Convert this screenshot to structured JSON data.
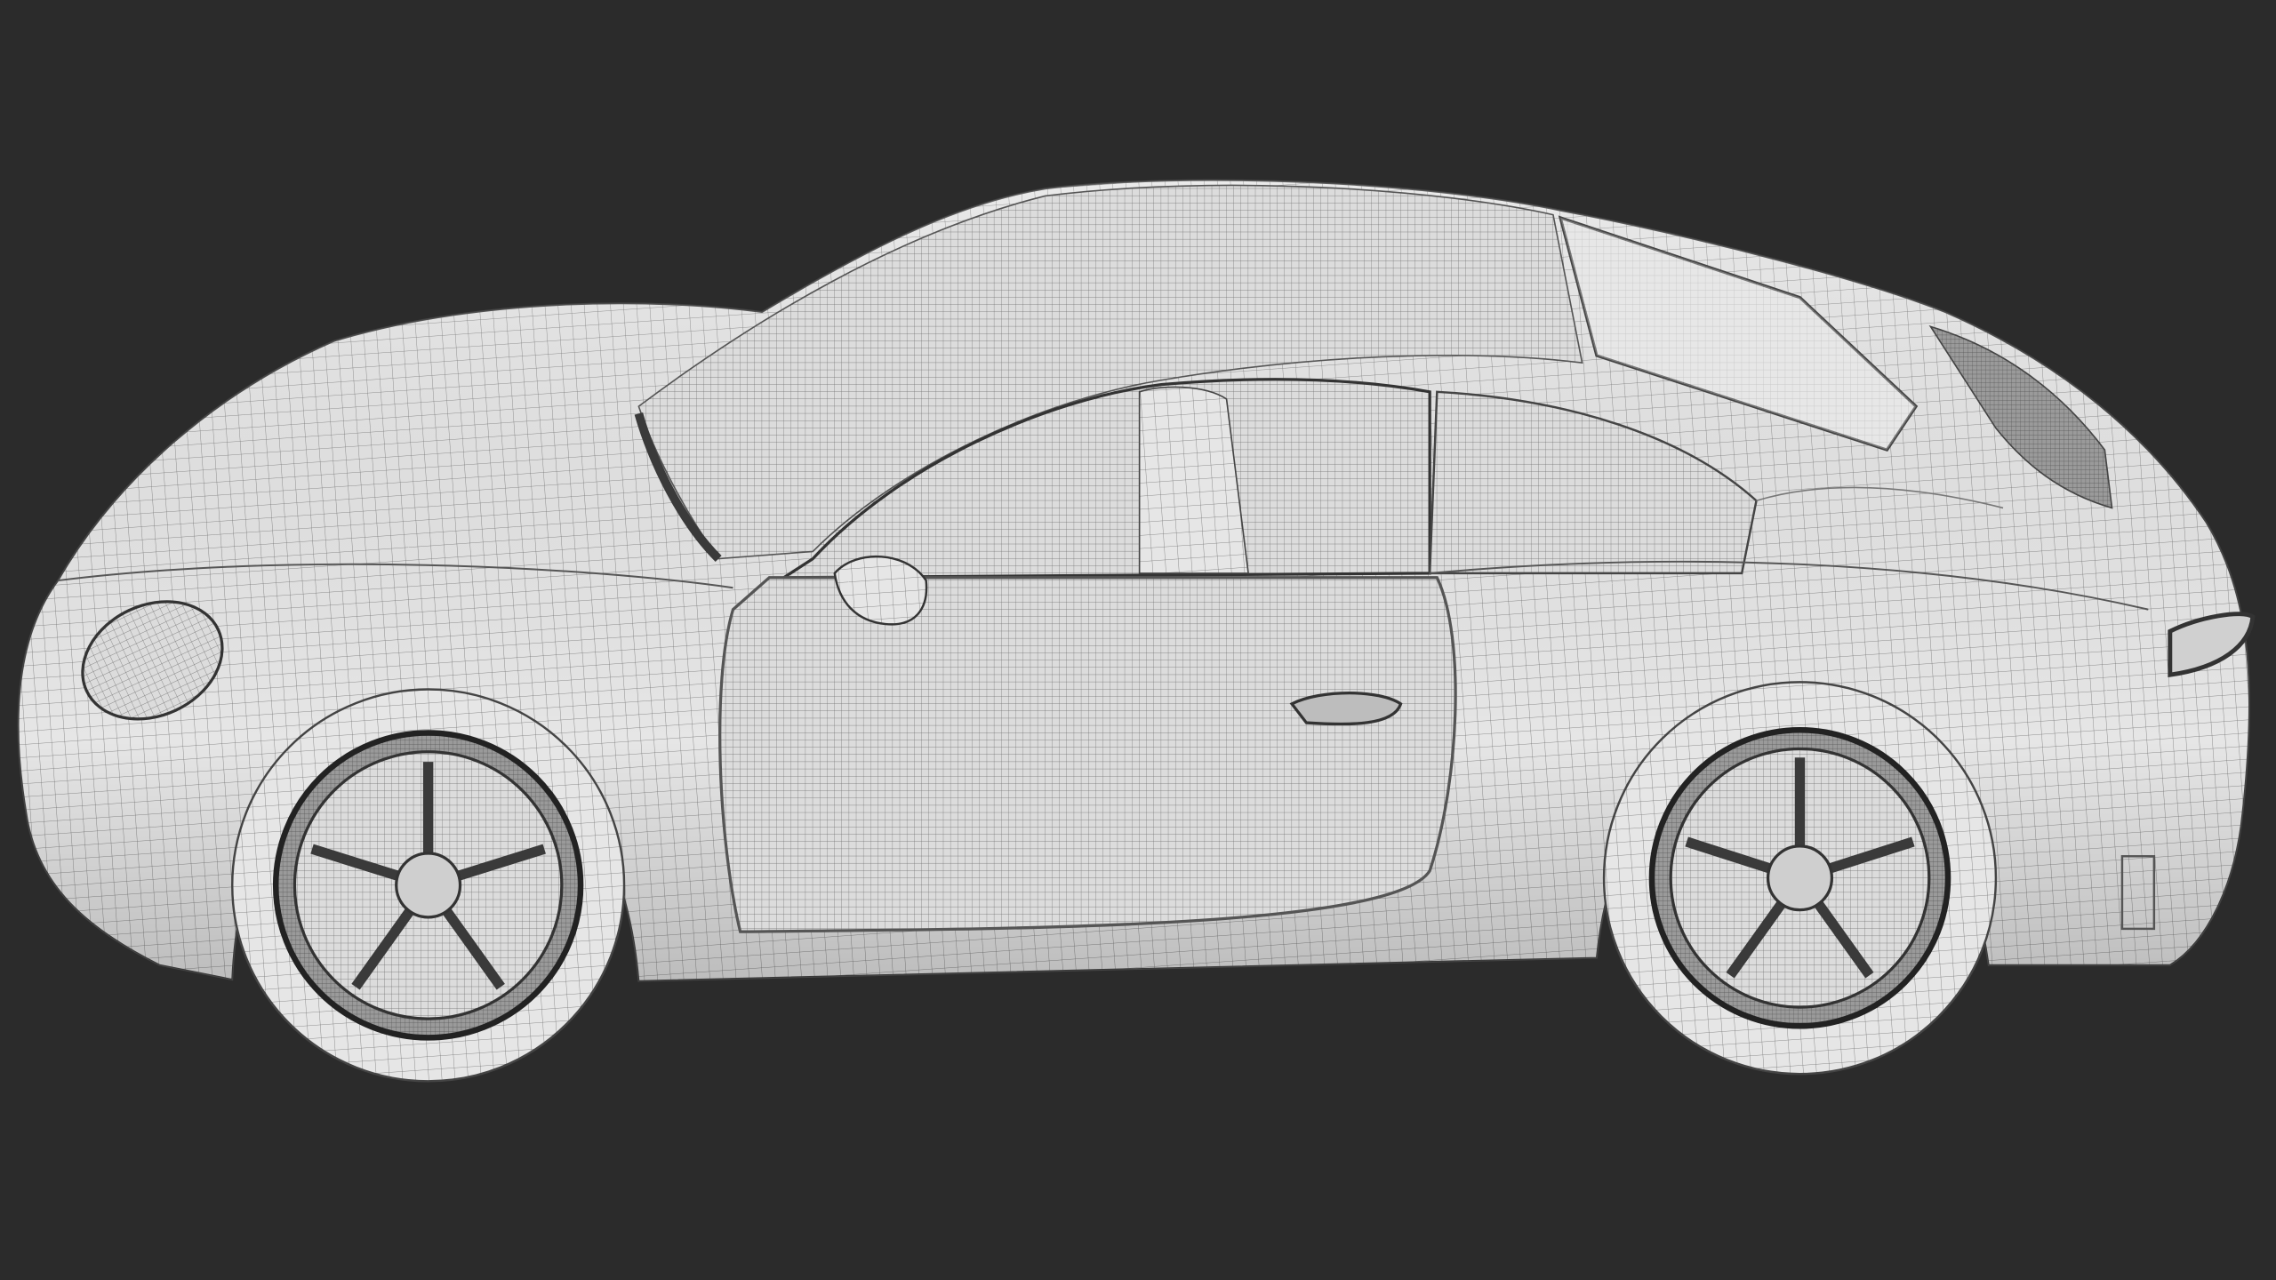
{
  "scene": {
    "subject": "car-wireframe-render",
    "colors": {
      "background": "#2b2b2b",
      "surface": "#e4e4e4",
      "wire": "#6a6a6a",
      "shadow": "#b8b8b8",
      "dark": "#3a3a3a"
    }
  }
}
